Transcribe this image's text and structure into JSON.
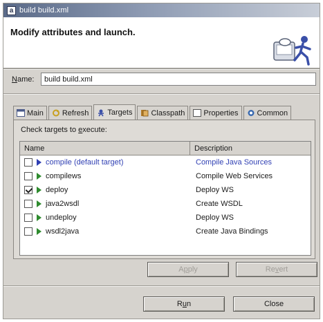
{
  "window": {
    "title": "build build.xml",
    "app_icon": "a"
  },
  "banner": {
    "title": "Modify attributes and launch.",
    "art": "ant-runner-icon"
  },
  "name_row": {
    "label_first": "N",
    "label_rest": "ame:",
    "value": "build build.xml"
  },
  "tabs": [
    {
      "label": "Main",
      "icon": "main-tab-icon"
    },
    {
      "label": "Refresh",
      "icon": "refresh-icon"
    },
    {
      "label": "Targets",
      "icon": "targets-icon",
      "active": true
    },
    {
      "label": "Classpath",
      "icon": "classpath-icon"
    },
    {
      "label": "Properties",
      "icon": "properties-icon"
    },
    {
      "label": "Common",
      "icon": "common-icon"
    }
  ],
  "targets_panel": {
    "check_label_a": "Check targets to ",
    "check_label_u": "e",
    "check_label_b": "xecute:",
    "columns": {
      "name": "Name",
      "description": "Description"
    },
    "rows": [
      {
        "name": "compile (default target)",
        "description": "Compile Java Sources",
        "checked": false,
        "default": true
      },
      {
        "name": "compilews",
        "description": "Compile Web Services",
        "checked": false
      },
      {
        "name": "deploy",
        "description": "Deploy WS",
        "checked": true
      },
      {
        "name": "java2wsdl",
        "description": "Create WSDL",
        "checked": false
      },
      {
        "name": "undeploy",
        "description": "Deploy WS",
        "checked": false
      },
      {
        "name": "wsdl2java",
        "description": "Create Java Bindings",
        "checked": false
      }
    ]
  },
  "buttons": {
    "apply_first": "A",
    "apply_u": "p",
    "apply_rest": "ply",
    "revert_first": "Re",
    "revert_u": "v",
    "revert_rest": "ert",
    "run_first": "R",
    "run_u": "u",
    "run_rest": "n",
    "close": "Close"
  },
  "colors": {
    "default_target": "#2f3fb3",
    "target_play": "#2e8b2e",
    "dialog_bg": "#d6d3ce"
  }
}
